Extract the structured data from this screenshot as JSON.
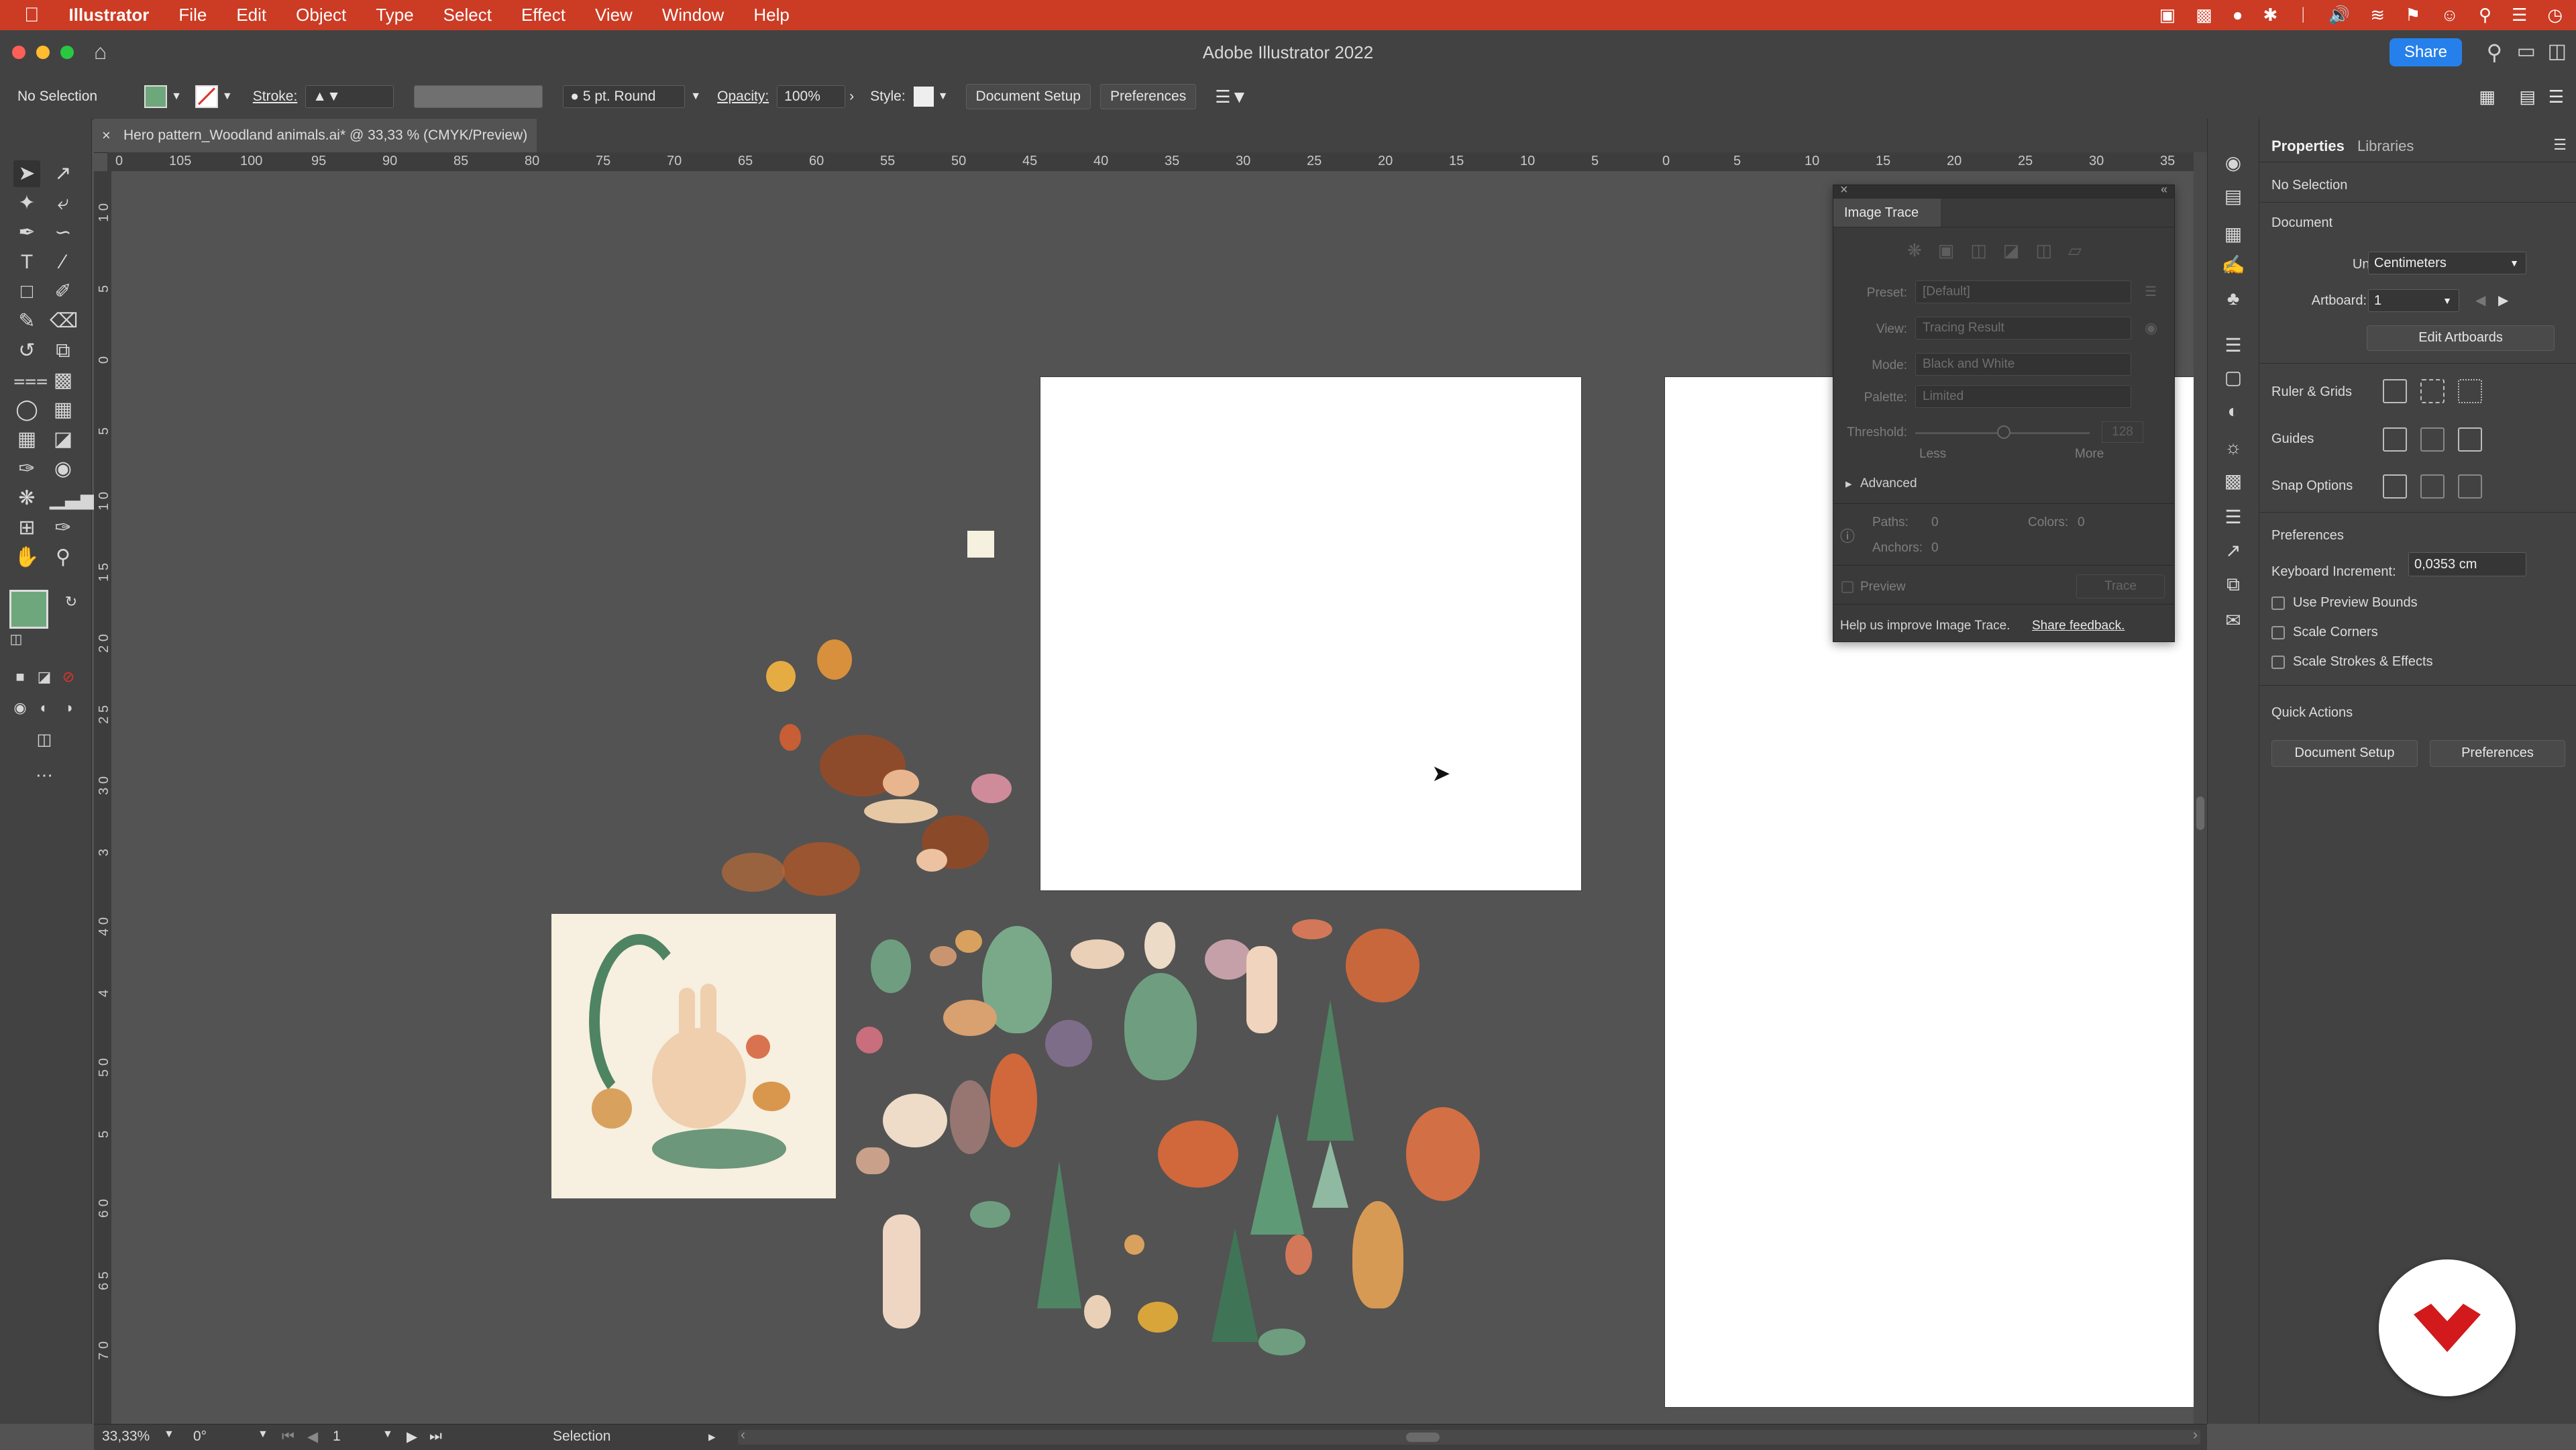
{
  "menubar": {
    "app": "Illustrator",
    "items": [
      "File",
      "Edit",
      "Object",
      "Type",
      "Select",
      "Effect",
      "View",
      "Window",
      "Help"
    ]
  },
  "titlebar": {
    "title": "Adobe Illustrator 2022",
    "share": "Share"
  },
  "control": {
    "selection": "No Selection",
    "stroke_label": "Stroke:",
    "brush": "5 pt. Round",
    "opacity_label": "Opacity:",
    "opacity_value": "100%",
    "style_label": "Style:",
    "document_setup": "Document Setup",
    "preferences": "Preferences"
  },
  "tab": {
    "title": "Hero pattern_Woodland animals.ai* @ 33,33 % (CMYK/Preview)"
  },
  "ruler_h": [
    "0",
    "105",
    "100",
    "95",
    "90",
    "85",
    "80",
    "75",
    "70",
    "65",
    "60",
    "55",
    "50",
    "45",
    "40",
    "35",
    "30",
    "25",
    "20",
    "15",
    "10",
    "5",
    "0",
    "5",
    "10",
    "15",
    "20",
    "25",
    "30",
    "35"
  ],
  "ruler_v": [
    "1 0",
    "5",
    "0",
    "5",
    "1 0",
    "1 5",
    "2 0",
    "2 5",
    "3 0",
    "3",
    "4 0",
    "4",
    "5 0",
    "5",
    "6 0",
    "6 5",
    "7 0"
  ],
  "image_trace": {
    "title": "Image Trace",
    "preset_label": "Preset:",
    "preset_value": "[Default]",
    "view_label": "View:",
    "view_value": "Tracing Result",
    "mode_label": "Mode:",
    "mode_value": "Black and White",
    "palette_label": "Palette:",
    "palette_value": "Limited",
    "threshold_label": "Threshold:",
    "threshold_value": "128",
    "less": "Less",
    "more": "More",
    "advanced": "Advanced",
    "paths_label": "Paths:",
    "paths_value": "0",
    "colors_label": "Colors:",
    "colors_value": "0",
    "anchors_label": "Anchors:",
    "anchors_value": "0",
    "preview": "Preview",
    "trace": "Trace",
    "help_text": "Help us improve Image Trace.",
    "feedback": "Share feedback."
  },
  "properties": {
    "tab_properties": "Properties",
    "tab_libraries": "Libraries",
    "no_selection": "No Selection",
    "document": "Document",
    "units_label": "Units:",
    "units_value": "Centimeters",
    "artboard_label": "Artboard:",
    "artboard_value": "1",
    "edit_artboards": "Edit Artboards",
    "ruler_grids": "Ruler & Grids",
    "guides": "Guides",
    "snap_options": "Snap Options",
    "preferences": "Preferences",
    "keyboard_increment_label": "Keyboard Increment:",
    "keyboard_increment_value": "0,0353 cm",
    "use_preview_bounds": "Use Preview Bounds",
    "scale_corners": "Scale Corners",
    "scale_strokes": "Scale Strokes & Effects",
    "quick_actions": "Quick Actions",
    "qa_document_setup": "Document Setup",
    "qa_preferences": "Preferences"
  },
  "status": {
    "zoom": "33,33%",
    "rotation": "0°",
    "artboard": "1",
    "tool": "Selection"
  },
  "colors": {
    "fill": "#6fa77c",
    "accent": "#cc3b24",
    "share": "#2680eb"
  }
}
